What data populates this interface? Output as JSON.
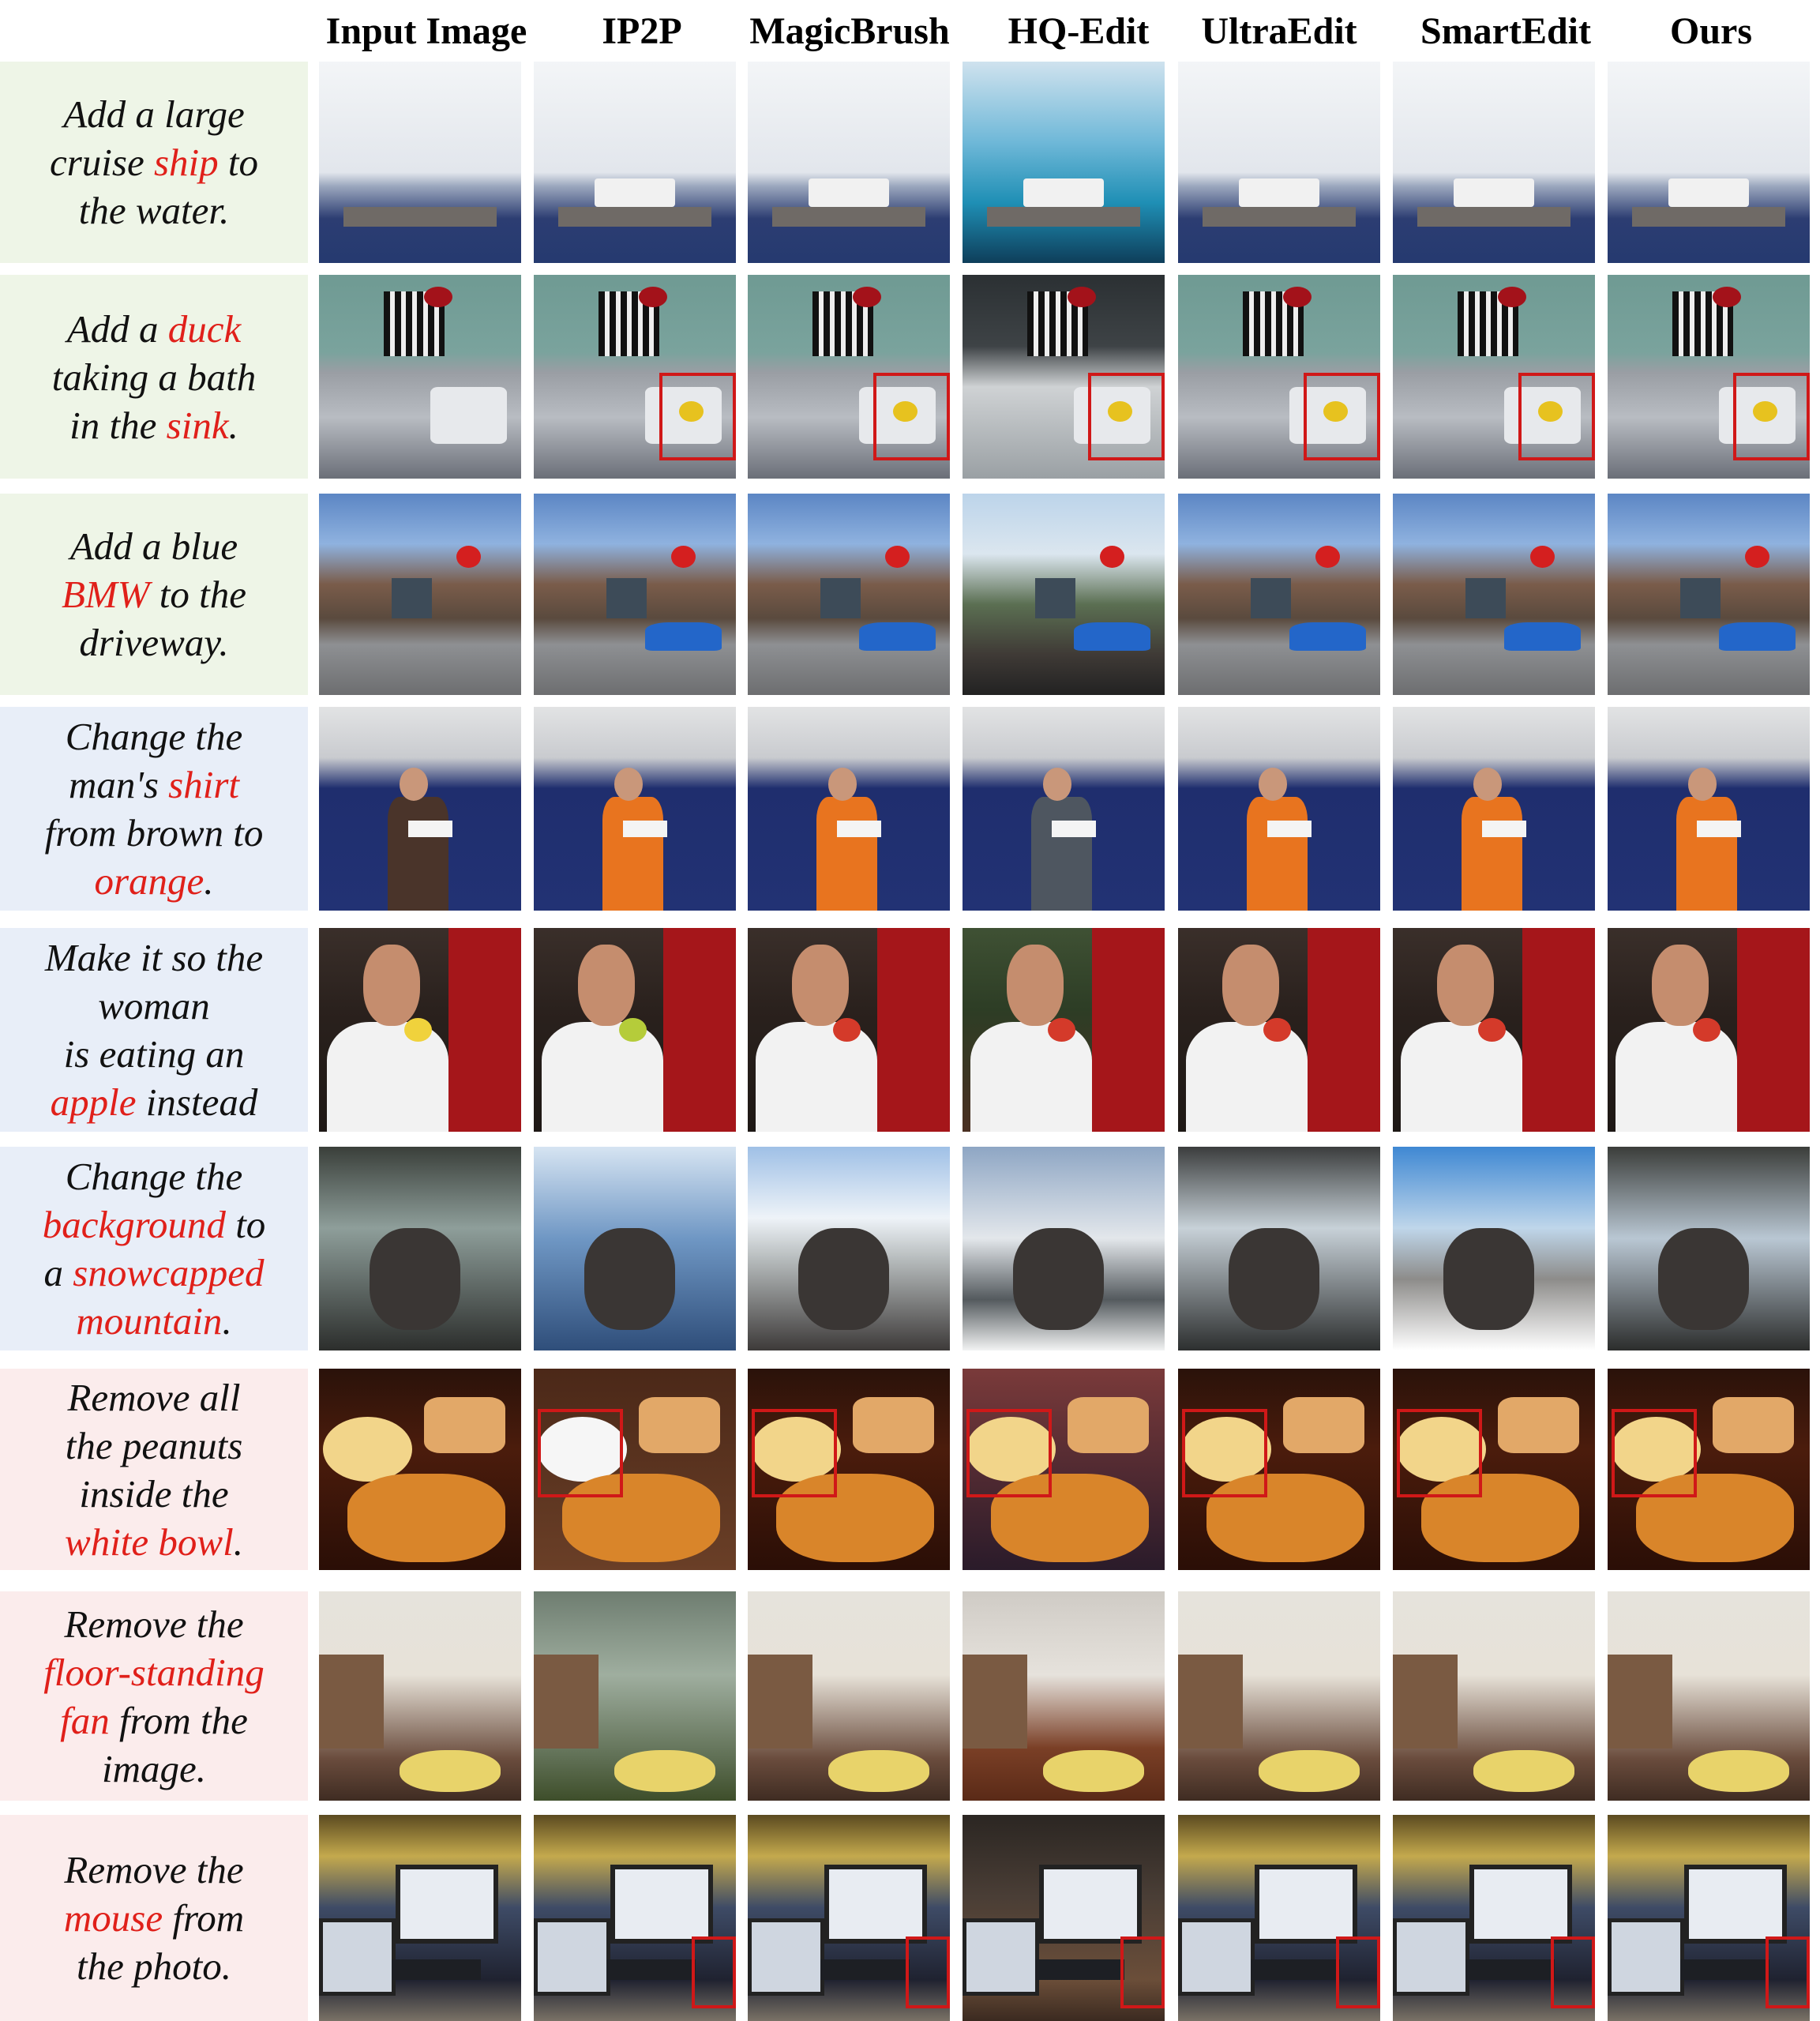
{
  "columns": [
    "Input Image",
    "IP2P",
    "MagicBrush",
    "HQ-Edit",
    "UltraEdit",
    "SmartEdit",
    "Ours"
  ],
  "rows": [
    {
      "category": "add",
      "prompt": [
        {
          "t": "Add a large"
        },
        {
          "t": "cruise "
        },
        {
          "t": "ship",
          "kw": true
        },
        {
          "t": " to"
        },
        {
          "t": "the water."
        }
      ],
      "prompt_lines": [
        [
          0
        ],
        [
          1,
          2,
          3
        ],
        [
          4
        ]
      ],
      "scene": "harbor",
      "highlight_box": false
    },
    {
      "category": "add",
      "prompt": [
        {
          "t": "Add a "
        },
        {
          "t": "duck",
          "kw": true
        },
        {
          "t": "taking a bath"
        },
        {
          "t": "in the "
        },
        {
          "t": "sink",
          "kw": true
        },
        {
          "t": "."
        }
      ],
      "prompt_lines": [
        [
          0,
          1
        ],
        [
          2
        ],
        [
          3,
          4,
          5
        ]
      ],
      "scene": "bathroom",
      "highlight_box": true
    },
    {
      "category": "add",
      "prompt": [
        {
          "t": "Add a blue"
        },
        {
          "t": "BMW",
          "kw": true
        },
        {
          "t": " to the"
        },
        {
          "t": "driveway."
        }
      ],
      "prompt_lines": [
        [
          0
        ],
        [
          1,
          2
        ],
        [
          3
        ]
      ],
      "scene": "driveway",
      "highlight_box": false
    },
    {
      "category": "change",
      "prompt": [
        {
          "t": "Change the"
        },
        {
          "t": "man's "
        },
        {
          "t": "shirt",
          "kw": true
        },
        {
          "t": "from brown to"
        },
        {
          "t": "orange",
          "kw": true
        },
        {
          "t": "."
        }
      ],
      "prompt_lines": [
        [
          0
        ],
        [
          1,
          2
        ],
        [
          3
        ],
        [
          4,
          5
        ]
      ],
      "scene": "man-shirt",
      "highlight_box": false
    },
    {
      "category": "change",
      "prompt": [
        {
          "t": "Make it so the"
        },
        {
          "t": "woman"
        },
        {
          "t": "is eating an"
        },
        {
          "t": "apple",
          "kw": true
        },
        {
          "t": " instead"
        }
      ],
      "prompt_lines": [
        [
          0
        ],
        [
          1
        ],
        [
          2
        ],
        [
          3,
          4
        ]
      ],
      "scene": "woman-eating",
      "highlight_box": false
    },
    {
      "category": "change",
      "prompt": [
        {
          "t": "Change the"
        },
        {
          "t": "background",
          "kw": true
        },
        {
          "t": " to"
        },
        {
          "t": "a "
        },
        {
          "t": "snowcapped",
          "kw": true
        },
        {
          "t": "mountain",
          "kw": true
        },
        {
          "t": "."
        }
      ],
      "prompt_lines": [
        [
          0
        ],
        [
          1,
          2
        ],
        [
          3,
          4
        ],
        [
          5,
          6
        ]
      ],
      "scene": "dog-car",
      "highlight_box": false
    },
    {
      "category": "remove",
      "prompt": [
        {
          "t": "Remove all"
        },
        {
          "t": "the peanuts"
        },
        {
          "t": "inside the"
        },
        {
          "t": "white bowl",
          "kw": true
        },
        {
          "t": "."
        }
      ],
      "prompt_lines": [
        [
          0
        ],
        [
          1
        ],
        [
          2
        ],
        [
          3,
          4
        ]
      ],
      "scene": "food-table",
      "highlight_box": true
    },
    {
      "category": "remove",
      "prompt": [
        {
          "t": "Remove the"
        },
        {
          "t": "floor-standing",
          "kw": true
        },
        {
          "t": "fan",
          "kw": true
        },
        {
          "t": " from the"
        },
        {
          "t": "image."
        }
      ],
      "prompt_lines": [
        [
          0
        ],
        [
          1
        ],
        [
          2,
          3
        ],
        [
          4
        ]
      ],
      "scene": "living-room",
      "highlight_box": false
    },
    {
      "category": "remove",
      "prompt": [
        {
          "t": "Remove the"
        },
        {
          "t": "mouse",
          "kw": true
        },
        {
          "t": " from"
        },
        {
          "t": "the photo."
        }
      ],
      "prompt_lines": [
        [
          0
        ],
        [
          1,
          2
        ],
        [
          3
        ]
      ],
      "scene": "desk",
      "highlight_box": true
    }
  ],
  "colors": {
    "add_bg": "#eef5e7",
    "change_bg": "#e8eef8",
    "remove_bg": "#fbecec",
    "keyword": "#e0201a",
    "highlight_box": "#d01818"
  }
}
